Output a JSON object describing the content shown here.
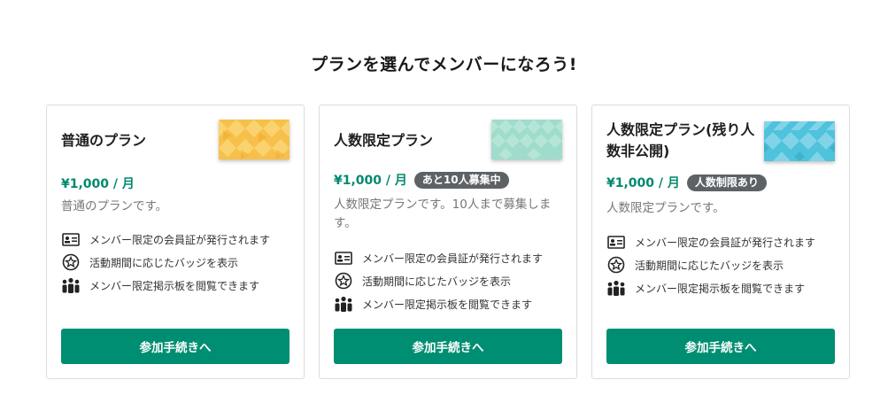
{
  "heading": "プランを選んでメンバーになろう!",
  "plans": [
    {
      "name": "普通のプラン",
      "price": "¥1,000 / 月",
      "badge": "",
      "description": "普通のプランです。",
      "thumbnail_color": "#f7c04a",
      "features": [
        {
          "icon": "id-card-icon",
          "text": "メンバー限定の会員証が発行されます"
        },
        {
          "icon": "badge-icon",
          "text": "活動期間に応じたバッジを表示"
        },
        {
          "icon": "people-icon",
          "text": "メンバー限定掲示板を閲覧できます"
        }
      ],
      "cta": "参加手続きへ"
    },
    {
      "name": "人数限定プラン",
      "price": "¥1,000 / 月",
      "badge": "あと10人募集中",
      "description": "人数限定プランです。10人まで募集します。",
      "thumbnail_color": "#9fdccc",
      "features": [
        {
          "icon": "id-card-icon",
          "text": "メンバー限定の会員証が発行されます"
        },
        {
          "icon": "badge-icon",
          "text": "活動期間に応じたバッジを表示"
        },
        {
          "icon": "people-icon",
          "text": "メンバー限定掲示板を閲覧できます"
        }
      ],
      "cta": "参加手続きへ"
    },
    {
      "name": "人数限定プラン(残り人数非公開)",
      "price": "¥1,000 / 月",
      "badge": "人数制限あり",
      "description": "人数限定プランです。",
      "thumbnail_color": "#4fc2dc",
      "features": [
        {
          "icon": "id-card-icon",
          "text": "メンバー限定の会員証が発行されます"
        },
        {
          "icon": "badge-icon",
          "text": "活動期間に応じたバッジを表示"
        },
        {
          "icon": "people-icon",
          "text": "メンバー限定掲示板を閲覧できます"
        }
      ],
      "cta": "参加手続きへ"
    }
  ],
  "colors": {
    "accent": "#008e72",
    "price": "#00896f",
    "badge_bg": "#5d6266"
  }
}
